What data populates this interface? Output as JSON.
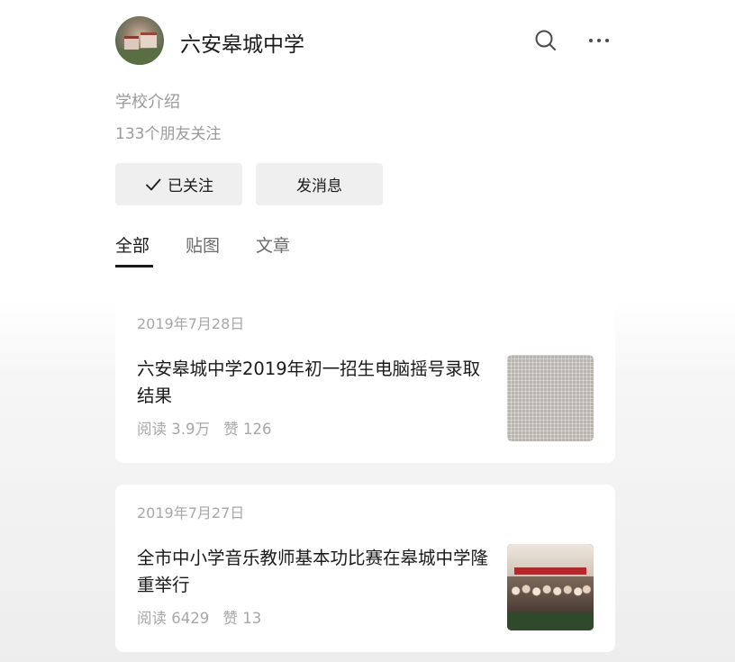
{
  "header": {
    "title": "六安皋城中学",
    "avatar_icon": "school-building-avatar",
    "search_icon": "search-icon",
    "more_icon": "more-icon"
  },
  "profile": {
    "description": "学校介绍",
    "followers": "133个朋友关注"
  },
  "actions": {
    "follow_label": "已关注",
    "message_label": "发消息"
  },
  "tabs": [
    {
      "label": "全部",
      "active": true
    },
    {
      "label": "贴图",
      "active": false
    },
    {
      "label": "文章",
      "active": false
    }
  ],
  "articles": [
    {
      "date": "2019年7月28日",
      "title": "六安皋城中学2019年初一招生电脑摇号录取结果",
      "reads": "阅读 3.9万",
      "likes": "赞 126",
      "thumbnail": "grid-document-thumbnail"
    },
    {
      "date": "2019年7月27日",
      "title": "全市中小学音乐教师基本功比赛在皋城中学隆重举行",
      "reads": "阅读 6429",
      "likes": "赞 13",
      "thumbnail": "group-photo-thumbnail"
    }
  ],
  "colors": {
    "text_primary": "#1a1a1a",
    "text_secondary": "#9a9a9a",
    "button_bg": "#efefef",
    "card_bg": "#ffffff",
    "page_bg_bottom": "#ededed"
  }
}
